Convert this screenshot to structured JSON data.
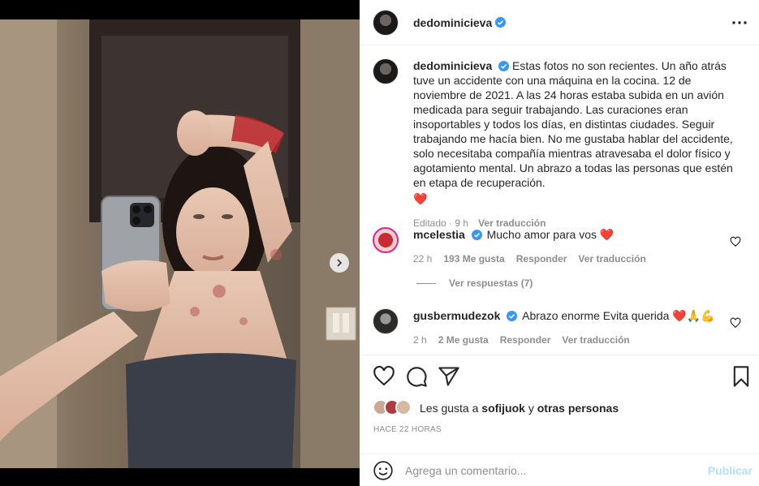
{
  "post": {
    "username": "dedominicieva",
    "caption": "Estas fotos no son recientes. Un año atrás tuve un accidente con una máquina en la cocina. 12 de noviembre de 2021. A las 24 horas estaba subida en un avión medicada para seguir trabajando. Las curaciones eran insoportables y todos los días, en distintas ciudades. Seguir trabajando me hacía bien. No me gustaba hablar del accidente, solo necesitaba compañía mientras atravesaba el dolor físico y agotamiento mental. Un abrazo a todas las personas que estén en etapa de recuperación.",
    "caption_emoji": "❤️",
    "edited_label": "Editado",
    "time": "9 h",
    "translate_label": "Ver traducción",
    "carousel": {
      "total": 2,
      "active_index": 1
    }
  },
  "comments": [
    {
      "username": "mcelestia",
      "text": "Mucho amor para vos",
      "emoji": "❤️",
      "time": "22 h",
      "likes": "193 Me gusta",
      "reply_label": "Responder",
      "translate_label": "Ver traducción",
      "replies_label": "Ver respuestas (7)"
    },
    {
      "username": "gusbermudezok",
      "text": "Abrazo enorme Evita querida",
      "emoji": "❤️🙏💪",
      "time": "2 h",
      "likes": "2 Me gusta",
      "reply_label": "Responder",
      "translate_label": "Ver traducción"
    }
  ],
  "likes_line": {
    "prefix": "Les gusta a",
    "user": "sofijuok",
    "connector": "y",
    "others": "otras personas"
  },
  "timestamp": "HACE 22 HORAS",
  "comment_box": {
    "placeholder": "Agrega un comentario...",
    "publish_label": "Publicar"
  },
  "icons": {
    "more": "more-options-icon",
    "like": "heart-icon",
    "comment": "comment-icon",
    "share": "send-icon",
    "save": "bookmark-icon",
    "emoji": "emoji-icon",
    "next": "chevron-right-icon",
    "verified": "verified-badge-icon"
  },
  "colors": {
    "verified": "#3897f0",
    "publish_disabled": "#b2dffc",
    "muted_text": "#8e8e8e"
  }
}
